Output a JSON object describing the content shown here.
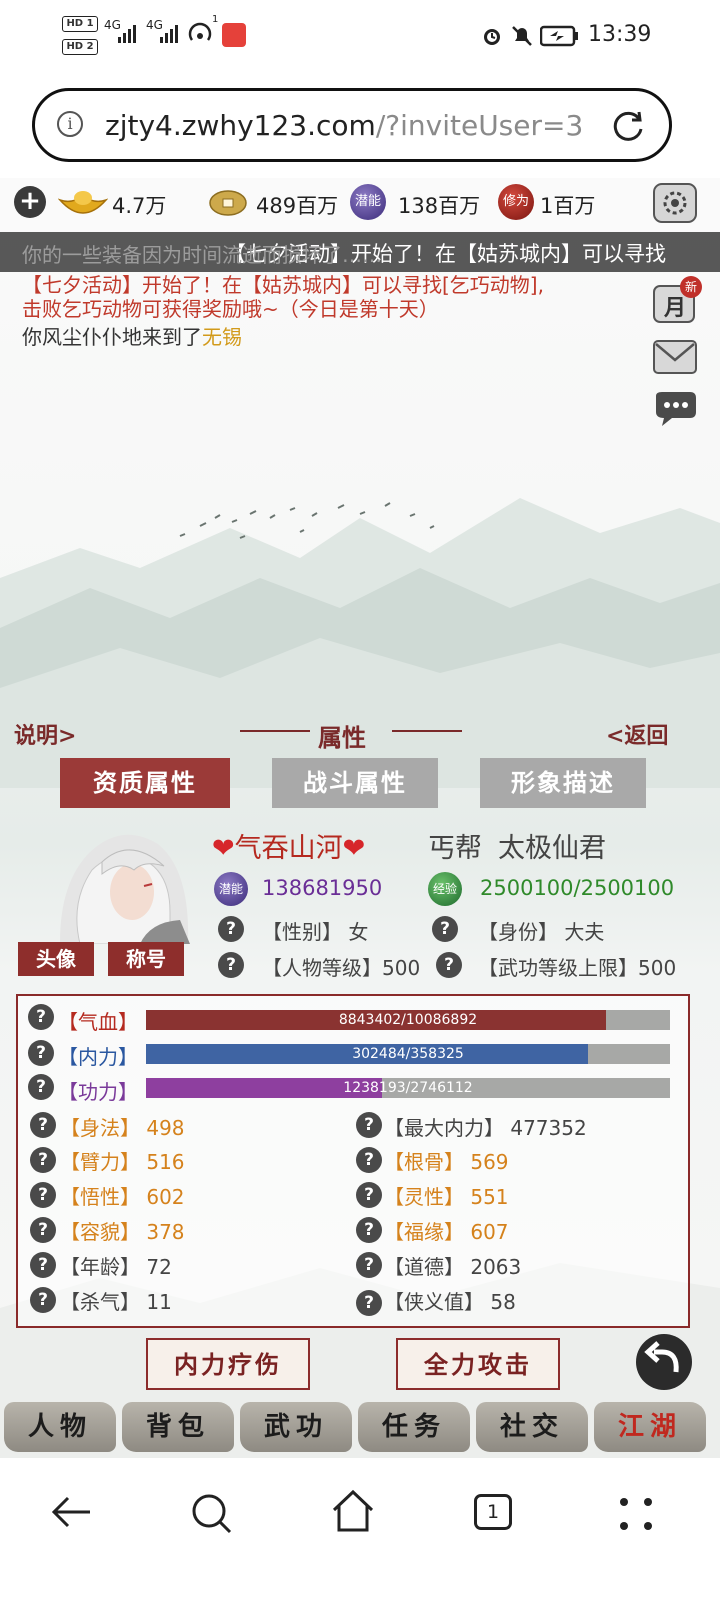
{
  "status_bar": {
    "hd1": "HD 1",
    "hd2": "HD 2",
    "signal1": "4G",
    "signal2": "4G",
    "notif_count": "1",
    "time": "13:39"
  },
  "browser": {
    "url_host": "zjty4.zwhy123.com",
    "url_path": "/?inviteUser=3"
  },
  "currency": {
    "gold": "4.7万",
    "coin": "489百万",
    "potential": "138百万",
    "cultivation": "1百万"
  },
  "currency_icons": {
    "potential": "潜能",
    "cultivation": "修为"
  },
  "marquee": "【七夕活动】开始了！在【姑苏城内】可以寻找",
  "messages": {
    "faded": "你的一些装备因为时间流逝而损坏了……",
    "event_line1": "【七夕活动】开始了！在【姑苏城内】可以寻找[乞巧动物],",
    "event_line2": "击败乞巧动物可获得奖励哦~（今日是第十天）",
    "arrive_prefix": "你风尘仆仆地来到了",
    "arrive_place": "无锡"
  },
  "side_icons": {
    "month_badge": "新",
    "month_label": "月"
  },
  "panel": {
    "help": "说明>",
    "title": "属性",
    "back": "<返回",
    "tabs": [
      "资质属性",
      "战斗属性",
      "形象描述"
    ]
  },
  "avatar_buttons": {
    "avatar": "头像",
    "title": "称号"
  },
  "player": {
    "name": "气吞山河",
    "sect": "丐帮",
    "rank": "太极仙君",
    "potential": "138681950",
    "exp": "2500100/2500100",
    "exp_icon": "经验",
    "gender_label": "【性别】",
    "gender": "女",
    "identity_label": "【身份】",
    "identity": "大夫",
    "level_label": "【人物等级】",
    "level": "500",
    "skill_cap_label": "【武功等级上限】",
    "skill_cap": "500"
  },
  "bars": {
    "hp_label": "【气血】",
    "hp_text": "8843402/10086892",
    "hp_fraction": 0.877,
    "mp_label": "【内力】",
    "mp_text": "302484/358325",
    "mp_fraction": 0.844,
    "gong_label": "【功力】",
    "gong_text": "1238193/2746112",
    "gong_fraction": 0.451
  },
  "stats_left": [
    {
      "label": "【身法】",
      "value": "498"
    },
    {
      "label": "【臂力】",
      "value": "516"
    },
    {
      "label": "【悟性】",
      "value": "602"
    },
    {
      "label": "【容貌】",
      "value": "378"
    },
    {
      "label": "【年龄】",
      "value": "72"
    },
    {
      "label": "【杀气】",
      "value": "11"
    }
  ],
  "stats_right": [
    {
      "label": "【最大内力】",
      "value": "477352"
    },
    {
      "label": "【根骨】",
      "value": "569"
    },
    {
      "label": "【灵性】",
      "value": "551"
    },
    {
      "label": "【福缘】",
      "value": "607"
    },
    {
      "label": "【道德】",
      "value": "2063"
    },
    {
      "label": "【侠义值】",
      "value": "58"
    }
  ],
  "actions": {
    "heal": "内力疗伤",
    "attack": "全力攻击"
  },
  "bottom_nav": [
    "人物",
    "背包",
    "武功",
    "任务",
    "社交",
    "江湖"
  ],
  "system_nav": {
    "tabs_count": "1"
  },
  "colors": {
    "hp": "#8a3331",
    "mp": "#3f64a3",
    "gong": "#8e3f9f",
    "accent_red": "#b5291f",
    "stat_orange": "#d5821c"
  }
}
